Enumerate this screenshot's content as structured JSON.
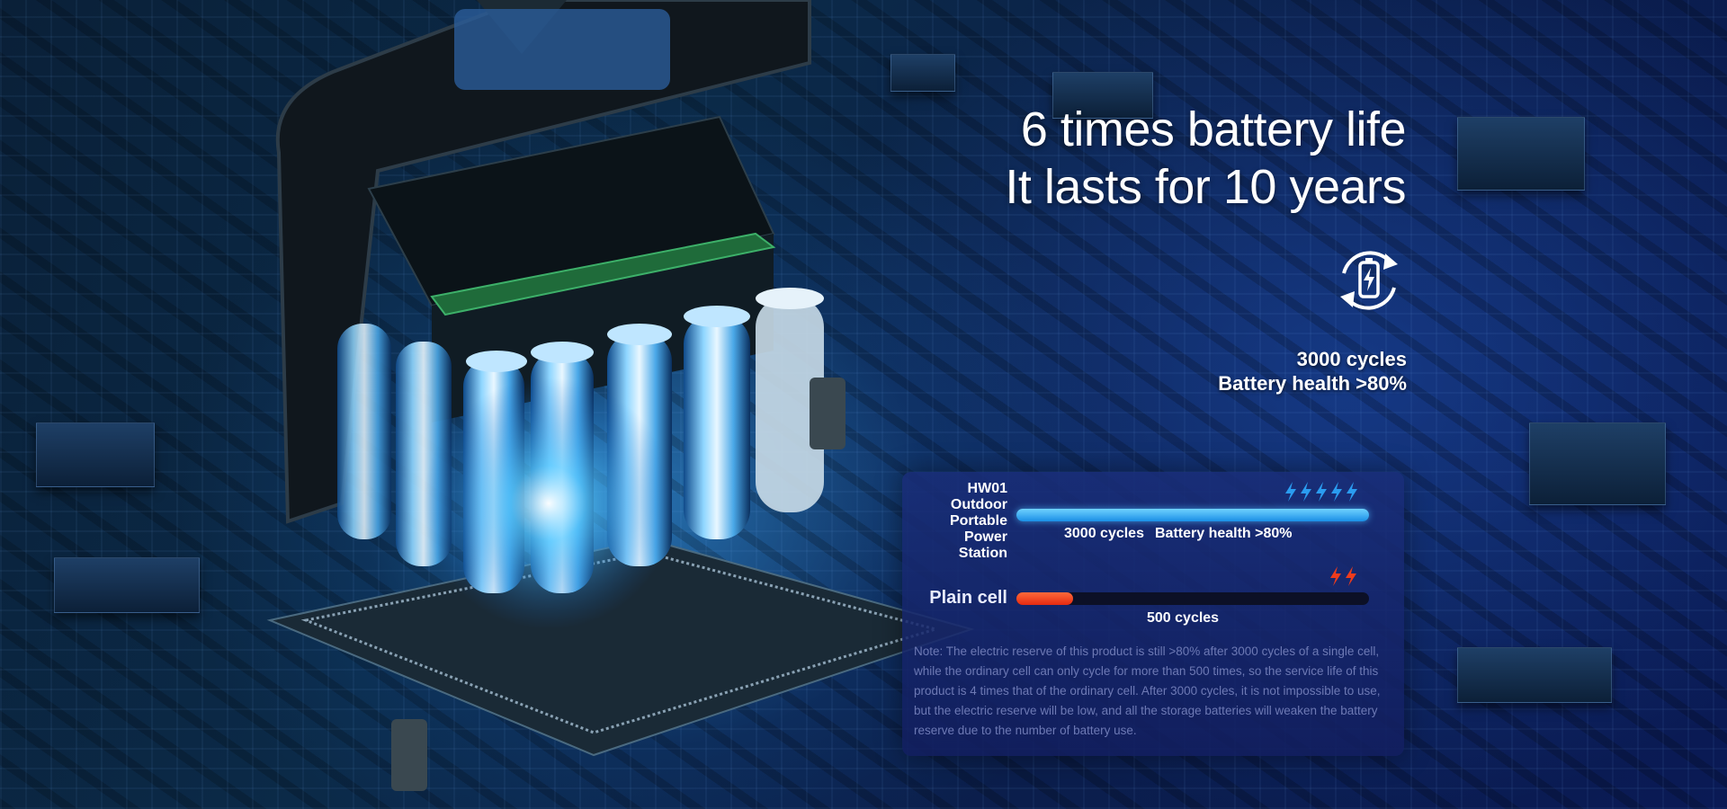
{
  "headline": {
    "line1": "6 times battery life",
    "line2": "It lasts for 10 years"
  },
  "summary": {
    "cycles": "3000 cycles",
    "health": "Battery health >80%",
    "icon": "battery-cycle-icon"
  },
  "comparison": {
    "hw01": {
      "label": "HW01 Outdoor Portable Power Station",
      "label_lines": [
        "HW01",
        "Outdoor",
        "Portable",
        "Power",
        "Station"
      ],
      "cycles_text": "3000 cycles",
      "health_text": "Battery health >80%",
      "relative_length": 1.0,
      "bolt_count": 5,
      "color": "#2a9cf0"
    },
    "plain": {
      "label": "Plain cell",
      "cycles_text": "500 cycles",
      "relative_length": 0.16,
      "bolt_count": 2,
      "color": "#ee3b1c"
    }
  },
  "note": "Note: The electric reserve of this product is still >80% after 3000 cycles of a single cell, while the ordinary cell can only cycle for more than 500 times, so the service life of this product is 4 times that of the ordinary cell. After 3000 cycles, it is not impossible to use, but the electric reserve will be low, and all the storage batteries will weaken the battery reserve due to the number of battery use.",
  "colors": {
    "background": "#0b2448",
    "panel": "#1c2f7a",
    "accent_blue": "#2a9cf0",
    "accent_red": "#ee3b1c",
    "note_text": "#6d79b4"
  }
}
